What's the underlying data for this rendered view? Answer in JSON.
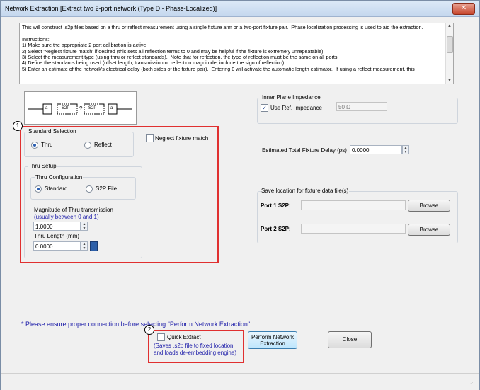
{
  "window": {
    "title": "Network Extraction [Extract two 2-port network (Type D - Phase-Localized)]",
    "close_label": "✕"
  },
  "instructions": {
    "text": "This will construct .s2p files based on a thru or reflect measurement using a single fixture arm or a two-port fixture pair.  Phase localization processing is used to aid the extraction.\n\nInstructions:\n1) Make sure the appropriate 2 port calibration is active.\n2) Select 'Neglect fixture match' if desired (this sets all reflection terms to 0 and may be helpful if the fixture is extremely unrepeatable).\n3) Select the measurement type (using thru or reflect standards).  Note that for reflection, the type of reflection must be the same on all ports.\n4) Define the standards being used (offset length, transmission or reflection magnitude, include the sign of reflection)\n5) Enter an estimate of the network's electrical delay (both sides of the fixture pair).  Entering 0 will activate the automatic length estimator.  If using a reflect measurement, this"
  },
  "diagram": {
    "label_a": "a",
    "label_s2p1": "S2P",
    "label_q": "?",
    "label_s2p2": "S2P",
    "label_b": "a"
  },
  "standard_selection": {
    "title": "Standard Selection",
    "thru": "Thru",
    "reflect": "Reflect",
    "neglect_match": "Neglect fixture match"
  },
  "thru_setup": {
    "title": "Thru Setup",
    "config_title": "Thru Configuration",
    "standard": "Standard",
    "s2p_file": "S2P File",
    "magnitude_label": "Magnitude of Thru transmission",
    "magnitude_hint": "(usually between 0 and 1)",
    "magnitude_value": "1.0000",
    "length_label": "Thru Length (mm)",
    "length_value": "0.0000"
  },
  "impedance": {
    "title": "Inner Plane Impedance",
    "use_ref": "Use Ref. Impedance",
    "value": "50 Ω"
  },
  "delay": {
    "label": "Estimated Total Fixture Delay  (ps)",
    "value": "0.0000"
  },
  "save": {
    "title": "Save location for fixture data file(s)",
    "port1_label": "Port 1 S2P:",
    "port1_value": "",
    "port2_label": "Port 2 S2P:",
    "port2_value": "",
    "browse": "Browse"
  },
  "notice": "* Please ensure proper connection before selecting \"Perform Network Extraction\".",
  "quick_extract": {
    "label": "Quick Extract",
    "hint1": "(Saves .s2p file to fixed location",
    "hint2": "and loads de-embedding engine)"
  },
  "actions": {
    "perform_line1": "Perform Network",
    "perform_line2": "Extraction",
    "close": "Close"
  },
  "badges": {
    "one": "1",
    "two": "2"
  },
  "colors": {
    "highlight": "#e03030",
    "hint_text": "#1a1aa8"
  }
}
